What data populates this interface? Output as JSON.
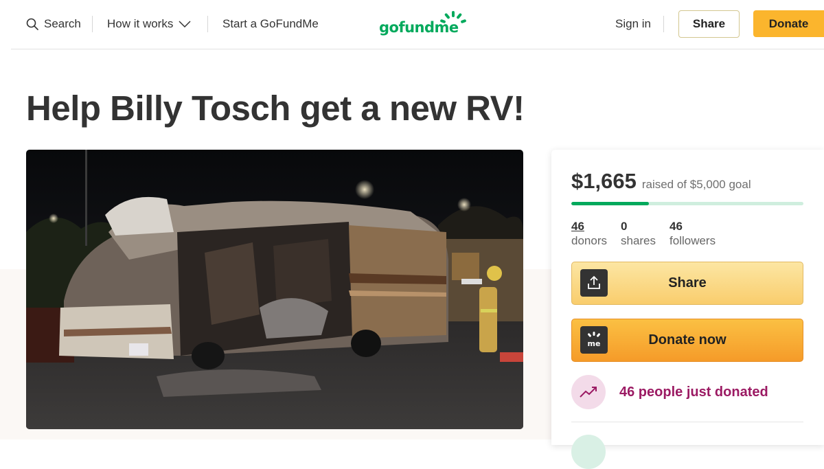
{
  "header": {
    "search_label": "Search",
    "how_label": "How it works",
    "start_label": "Start a GoFundMe",
    "logo_text": "gofundme",
    "signin_label": "Sign in",
    "share_label": "Share",
    "donate_label": "Donate"
  },
  "campaign": {
    "title": "Help Billy Tosch get a new RV!"
  },
  "card": {
    "raised_amount": "$1,665",
    "raised_goal_text": "raised of $5,000 goal",
    "progress_fraction": 0.333,
    "stats": [
      {
        "value": "46",
        "label": "donors"
      },
      {
        "value": "0",
        "label": "shares"
      },
      {
        "value": "46",
        "label": "followers"
      }
    ],
    "share_button": "Share",
    "donate_button": "Donate now",
    "recent_donations": "46 people just donated"
  },
  "colors": {
    "brand_green": "#02a95c",
    "donate_orange": "#fbb52d",
    "recent_magenta": "#9b1a63"
  },
  "icons": [
    "search-icon",
    "chevron-down-icon",
    "share-upload-icon",
    "gofundme-me-icon",
    "trending-up-icon"
  ]
}
